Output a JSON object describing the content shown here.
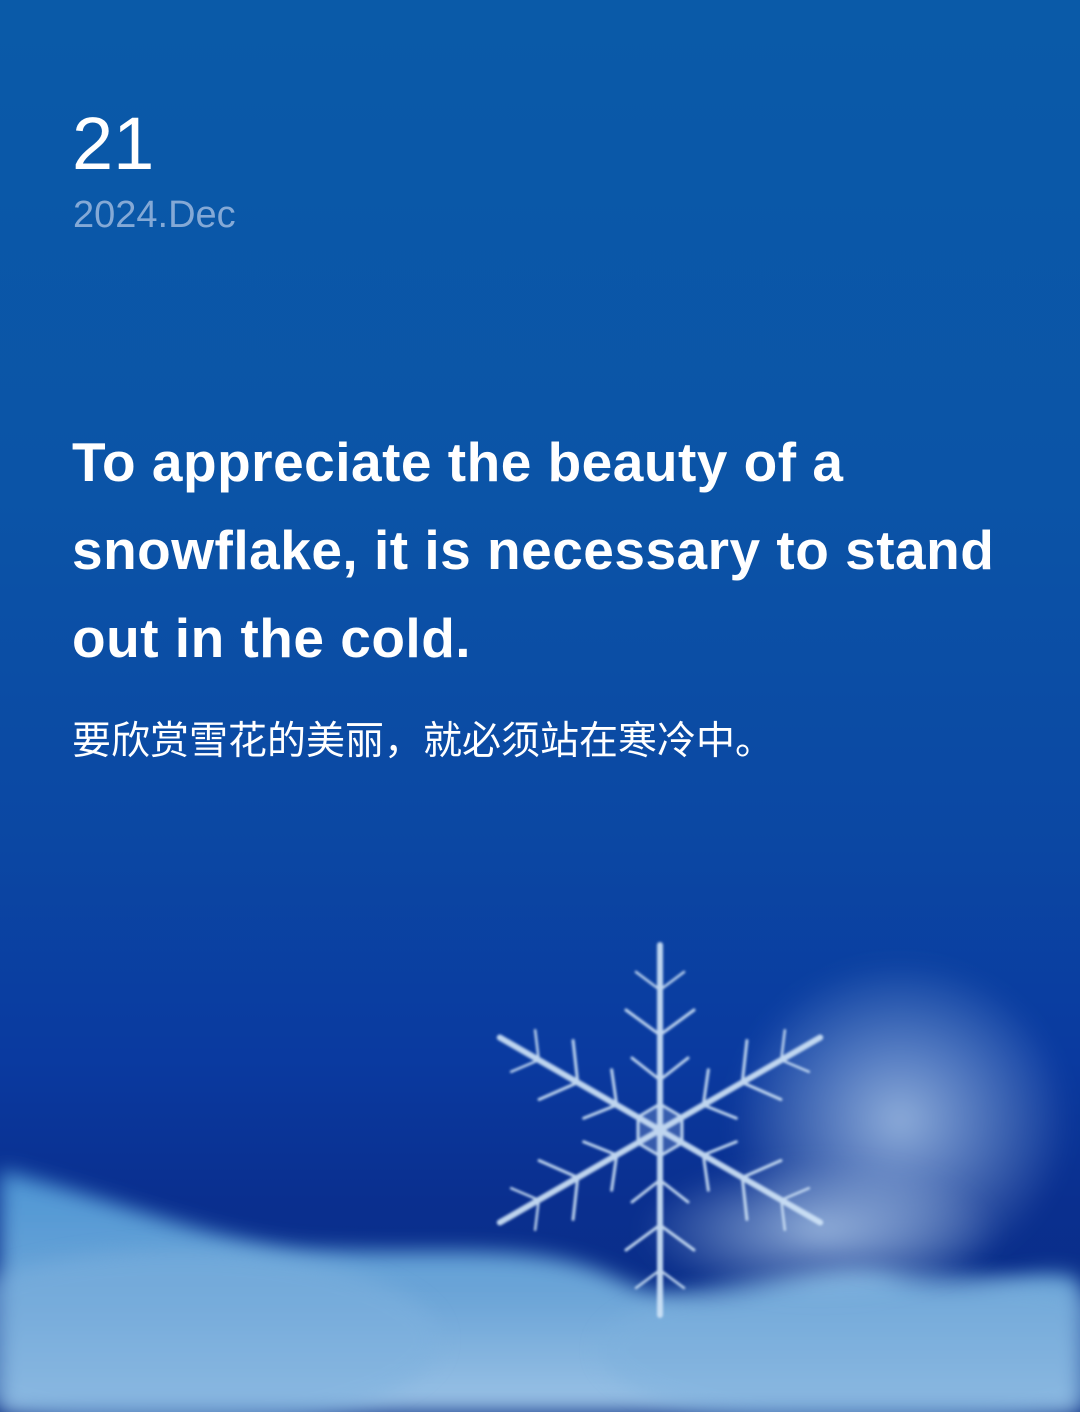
{
  "date": {
    "day": "21",
    "month": "2024.Dec"
  },
  "quote": {
    "english": "To appreciate the beauty of a snowflake, it is necessary to stand out in the cold.",
    "chinese": "要欣赏雪花的美丽，就必须站在寒冷中。"
  },
  "colors": {
    "background_top": "#0a5aa8",
    "background_bottom": "#0a2d82",
    "text_primary": "#ffffff",
    "text_secondary": "#84a9d6",
    "snow": "#6ea6d8"
  },
  "icons": {
    "snowflake": "snowflake-icon"
  }
}
